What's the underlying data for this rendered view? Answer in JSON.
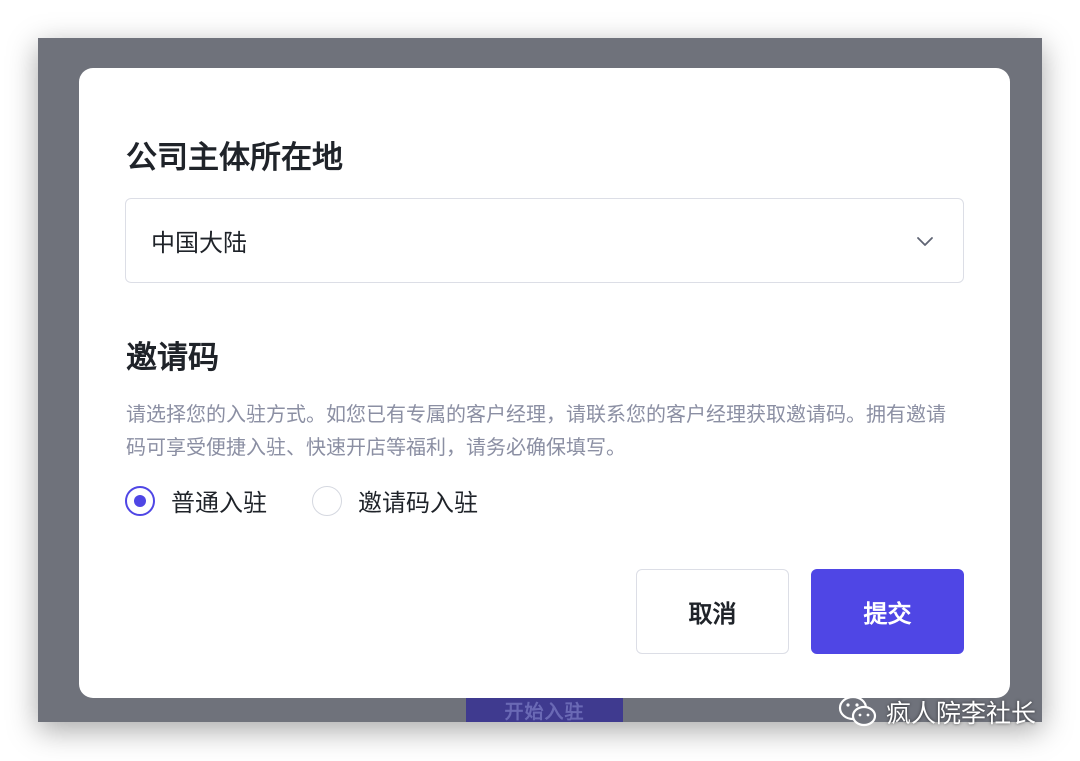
{
  "background": {
    "underlying_button_label": "开始入驻"
  },
  "modal": {
    "location": {
      "title": "公司主体所在地",
      "selected_value": "中国大陆"
    },
    "invite": {
      "title": "邀请码",
      "description": "请选择您的入驻方式。如您已有专属的客户经理，请联系您的客户经理获取邀请码。拥有邀请码可享受便捷入驻、快速开店等福利，请务必确保填写。",
      "options": [
        {
          "label": "普通入驻",
          "checked": true
        },
        {
          "label": "邀请码入驻",
          "checked": false
        }
      ]
    },
    "buttons": {
      "cancel_label": "取消",
      "submit_label": "提交"
    }
  },
  "watermark": {
    "text": "疯人院李社长"
  },
  "colors": {
    "accent": "#4f46e5",
    "overlay": "#6f727b",
    "text_primary": "#1f2329",
    "text_secondary": "#8b8fa3"
  },
  "icons": {
    "select_chevron": "chevron-down-icon",
    "watermark_logo": "wechat-icon"
  }
}
